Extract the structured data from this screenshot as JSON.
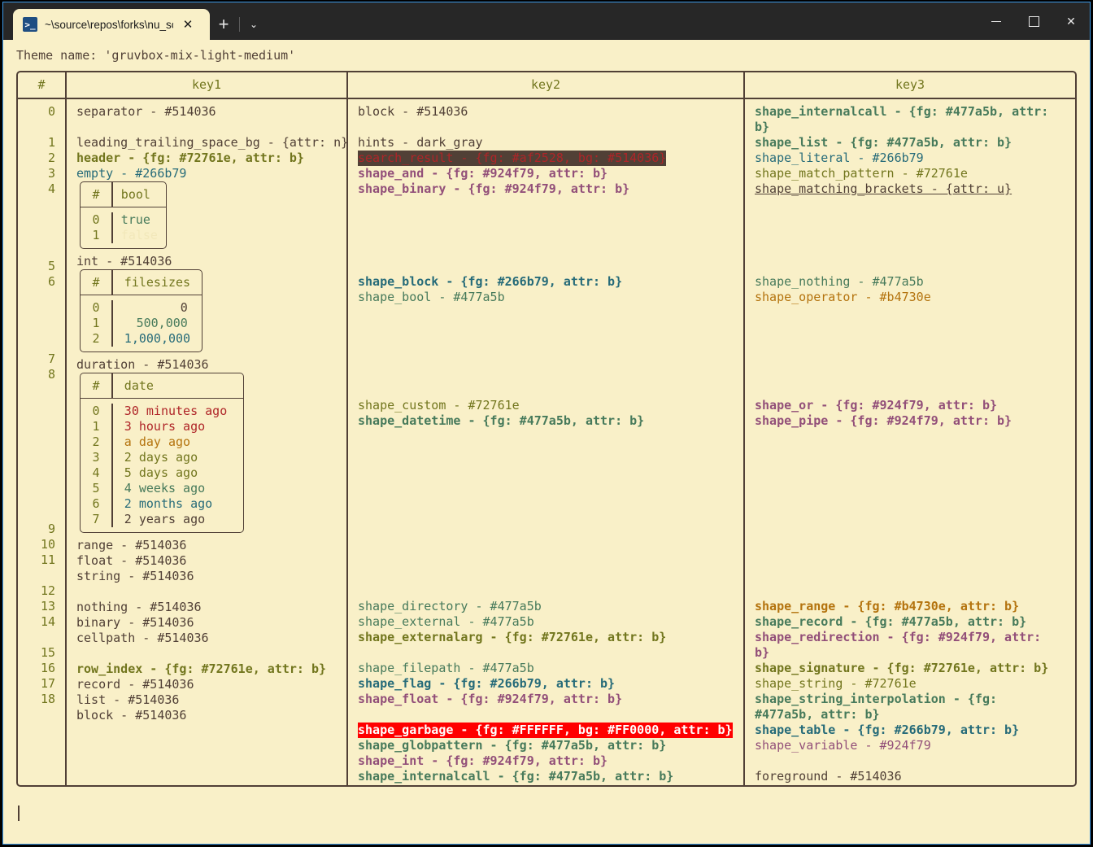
{
  "window": {
    "tab": {
      "icon": "powershell-icon",
      "icon_glyph": ">_",
      "title": "~\\source\\repos\\forks\\nu_scrip",
      "close_glyph": "✕"
    },
    "new_tab_glyph": "+",
    "dropdown_glyph": "⌄",
    "controls": {
      "minimize": "–",
      "maximize": "□",
      "close": "✕"
    }
  },
  "terminal": {
    "theme_line": "Theme name: 'gruvbox-mix-light-medium'",
    "prompt_cursor": true
  },
  "colors": {
    "background": "#f9f0c8",
    "foreground": "#514036",
    "border": "#514036",
    "header": "#72761e",
    "teal": "#266b79",
    "green": "#477a5b",
    "purple": "#924f79",
    "orange": "#b4730e",
    "red": "#af2528",
    "faint": "#f2e8ba",
    "garbage_bg": "#FF0000",
    "garbage_fg": "#FFFFFF",
    "search_bg": "#514036",
    "accent_window": "#3d9ae8",
    "titlebar": "#272727"
  },
  "table": {
    "headers": [
      "#",
      "key1",
      "key2",
      "key3"
    ],
    "row_indices": [
      "0",
      "",
      "1",
      "2",
      "3",
      "4",
      "",
      "",
      "",
      "",
      "5",
      "6",
      "",
      "",
      "",
      "",
      "7",
      "8",
      "",
      "",
      "",
      "",
      "",
      "",
      "",
      "",
      "",
      "9",
      "10",
      "11",
      "",
      "12",
      "13",
      "14",
      "",
      "15",
      "16",
      "17",
      "18"
    ],
    "key1": [
      {
        "t": "separator - #514036",
        "c": "fg-base"
      },
      {
        "t": "",
        "c": "blank"
      },
      {
        "t": "leading_trailing_space_bg - {attr: n}",
        "c": "fg-base"
      },
      {
        "t": "header - {fg: #72761e, attr: b}",
        "c": "fg-olive bold"
      },
      {
        "t": "empty - #266b79",
        "c": "fg-teal"
      }
    ],
    "key1_bool_table": {
      "headers": [
        "#",
        "bool"
      ],
      "rows": [
        {
          "idx": "0",
          "val": "true",
          "color": "fg-green"
        },
        {
          "idx": "1",
          "val": "false",
          "color": "fg-faint"
        }
      ]
    },
    "key1_mid": [
      {
        "t": "int - #514036",
        "c": "fg-base"
      }
    ],
    "key1_filesizes_table": {
      "headers": [
        "#",
        "filesizes"
      ],
      "rows": [
        {
          "idx": "0",
          "val": "0",
          "color": "fg-base"
        },
        {
          "idx": "1",
          "val": "500,000",
          "color": "fg-green"
        },
        {
          "idx": "2",
          "val": "1,000,000",
          "color": "fg-teal"
        }
      ]
    },
    "key1_mid2": [
      {
        "t": "duration - #514036",
        "c": "fg-base"
      }
    ],
    "key1_date_table": {
      "headers": [
        "#",
        "date"
      ],
      "rows": [
        {
          "idx": "0",
          "val": "30 minutes ago",
          "color": "fg-red"
        },
        {
          "idx": "1",
          "val": "3 hours ago",
          "color": "fg-red"
        },
        {
          "idx": "2",
          "val": "a day ago",
          "color": "fg-orange"
        },
        {
          "idx": "3",
          "val": "2 days ago",
          "color": "fg-olive"
        },
        {
          "idx": "4",
          "val": "5 days ago",
          "color": "fg-olive"
        },
        {
          "idx": "5",
          "val": "4 weeks ago",
          "color": "fg-green"
        },
        {
          "idx": "6",
          "val": "2 months ago",
          "color": "fg-teal"
        },
        {
          "idx": "7",
          "val": "2 years ago",
          "color": "fg-base"
        }
      ]
    },
    "key1_tail": [
      {
        "t": "range - #514036",
        "c": "fg-base"
      },
      {
        "t": "float - #514036",
        "c": "fg-base"
      },
      {
        "t": "string - #514036",
        "c": "fg-base"
      },
      {
        "t": "",
        "c": "blank"
      },
      {
        "t": "nothing - #514036",
        "c": "fg-base"
      },
      {
        "t": "binary - #514036",
        "c": "fg-base"
      },
      {
        "t": "cellpath - #514036",
        "c": "fg-base"
      },
      {
        "t": "",
        "c": "blank"
      },
      {
        "t": "row_index - {fg: #72761e, attr: b}",
        "c": "fg-olive bold"
      },
      {
        "t": "record - #514036",
        "c": "fg-base"
      },
      {
        "t": "list - #514036",
        "c": "fg-base"
      },
      {
        "t": "block - #514036",
        "c": "fg-base"
      }
    ],
    "key2": [
      {
        "t": "block - #514036",
        "c": "fg-base"
      },
      {
        "t": "",
        "c": "blank"
      },
      {
        "t": "hints - dark_gray",
        "c": "fg-base"
      },
      {
        "t": "search_result - {fg: #af2528, bg: #514036}",
        "c": "hl-search"
      },
      {
        "t": "shape_and - {fg: #924f79, attr: b}",
        "c": "fg-purple bold"
      },
      {
        "t": "shape_binary - {fg: #924f79, attr: b}",
        "c": "fg-purple bold"
      },
      {
        "t": "",
        "c": "blank"
      },
      {
        "t": "",
        "c": "blank"
      },
      {
        "t": "",
        "c": "blank"
      },
      {
        "t": "",
        "c": "blank"
      },
      {
        "t": "",
        "c": "blank"
      },
      {
        "t": "shape_block - {fg: #266b79, attr: b}",
        "c": "fg-teal bold"
      },
      {
        "t": "shape_bool - #477a5b",
        "c": "fg-green"
      },
      {
        "t": "",
        "c": "blank"
      },
      {
        "t": "",
        "c": "blank"
      },
      {
        "t": "",
        "c": "blank"
      },
      {
        "t": "",
        "c": "blank"
      },
      {
        "t": "",
        "c": "blank"
      },
      {
        "t": "",
        "c": "blank"
      },
      {
        "t": "shape_custom - #72761e",
        "c": "fg-olive"
      },
      {
        "t": "shape_datetime - {fg: #477a5b, attr: b}",
        "c": "fg-green bold"
      },
      {
        "t": "",
        "c": "blank"
      },
      {
        "t": "",
        "c": "blank"
      },
      {
        "t": "",
        "c": "blank"
      },
      {
        "t": "",
        "c": "blank"
      },
      {
        "t": "",
        "c": "blank"
      },
      {
        "t": "",
        "c": "blank"
      },
      {
        "t": "",
        "c": "blank"
      },
      {
        "t": "",
        "c": "blank"
      },
      {
        "t": "",
        "c": "blank"
      },
      {
        "t": "",
        "c": "blank"
      },
      {
        "t": "",
        "c": "blank"
      },
      {
        "t": "shape_directory - #477a5b",
        "c": "fg-green"
      },
      {
        "t": "shape_external - #477a5b",
        "c": "fg-green"
      },
      {
        "t": "shape_externalarg - {fg: #72761e, attr: b}",
        "c": "fg-olive bold"
      },
      {
        "t": "",
        "c": "blank"
      },
      {
        "t": "shape_filepath - #477a5b",
        "c": "fg-green"
      },
      {
        "t": "shape_flag - {fg: #266b79, attr: b}",
        "c": "fg-teal bold"
      },
      {
        "t": "shape_float - {fg: #924f79, attr: b}",
        "c": "fg-purple bold"
      },
      {
        "t": "",
        "c": "blank"
      },
      {
        "t": "shape_garbage - {fg: #FFFFFF, bg: #FF0000, attr: b}",
        "c": "hl-garbage"
      },
      {
        "t": "shape_globpattern - {fg: #477a5b, attr: b}",
        "c": "fg-green bold"
      },
      {
        "t": "shape_int - {fg: #924f79, attr: b}",
        "c": "fg-purple bold"
      },
      {
        "t": "shape_internalcall - {fg: #477a5b, attr: b}",
        "c": "fg-green bold"
      }
    ],
    "key3": [
      {
        "t": "shape_internalcall - {fg: #477a5b, attr:",
        "c": "fg-green bold"
      },
      {
        "t": "b}",
        "c": "fg-green bold"
      },
      {
        "t": "shape_list - {fg: #477a5b, attr: b}",
        "c": "fg-green bold"
      },
      {
        "t": "shape_literal - #266b79",
        "c": "fg-teal"
      },
      {
        "t": "shape_match_pattern - #72761e",
        "c": "fg-olive"
      },
      {
        "t": "shape_matching_brackets - {attr: u}",
        "c": "fg-base ul"
      },
      {
        "t": "",
        "c": "blank"
      },
      {
        "t": "",
        "c": "blank"
      },
      {
        "t": "",
        "c": "blank"
      },
      {
        "t": "",
        "c": "blank"
      },
      {
        "t": "",
        "c": "blank"
      },
      {
        "t": "shape_nothing - #477a5b",
        "c": "fg-green"
      },
      {
        "t": "shape_operator - #b4730e",
        "c": "fg-orange"
      },
      {
        "t": "",
        "c": "blank"
      },
      {
        "t": "",
        "c": "blank"
      },
      {
        "t": "",
        "c": "blank"
      },
      {
        "t": "",
        "c": "blank"
      },
      {
        "t": "",
        "c": "blank"
      },
      {
        "t": "",
        "c": "blank"
      },
      {
        "t": "shape_or - {fg: #924f79, attr: b}",
        "c": "fg-purple bold"
      },
      {
        "t": "shape_pipe - {fg: #924f79, attr: b}",
        "c": "fg-purple bold"
      },
      {
        "t": "",
        "c": "blank"
      },
      {
        "t": "",
        "c": "blank"
      },
      {
        "t": "",
        "c": "blank"
      },
      {
        "t": "",
        "c": "blank"
      },
      {
        "t": "",
        "c": "blank"
      },
      {
        "t": "",
        "c": "blank"
      },
      {
        "t": "",
        "c": "blank"
      },
      {
        "t": "",
        "c": "blank"
      },
      {
        "t": "",
        "c": "blank"
      },
      {
        "t": "",
        "c": "blank"
      },
      {
        "t": "",
        "c": "blank"
      },
      {
        "t": "shape_range - {fg: #b4730e, attr: b}",
        "c": "fg-orange bold"
      },
      {
        "t": "shape_record - {fg: #477a5b, attr: b}",
        "c": "fg-green bold"
      },
      {
        "t": "shape_redirection - {fg: #924f79, attr:",
        "c": "fg-purple bold"
      },
      {
        "t": "b}",
        "c": "fg-purple bold"
      },
      {
        "t": "shape_signature - {fg: #72761e, attr: b}",
        "c": "fg-olive bold"
      },
      {
        "t": "shape_string - #72761e",
        "c": "fg-olive"
      },
      {
        "t": "shape_string_interpolation - {fg:",
        "c": "fg-green bold"
      },
      {
        "t": "#477a5b, attr: b}",
        "c": "fg-green bold"
      },
      {
        "t": "shape_table - {fg: #266b79, attr: b}",
        "c": "fg-teal bold"
      },
      {
        "t": "shape_variable - #924f79",
        "c": "fg-purple"
      },
      {
        "t": "",
        "c": "blank"
      },
      {
        "t": "foreground - #514036",
        "c": "fg-base"
      }
    ]
  }
}
